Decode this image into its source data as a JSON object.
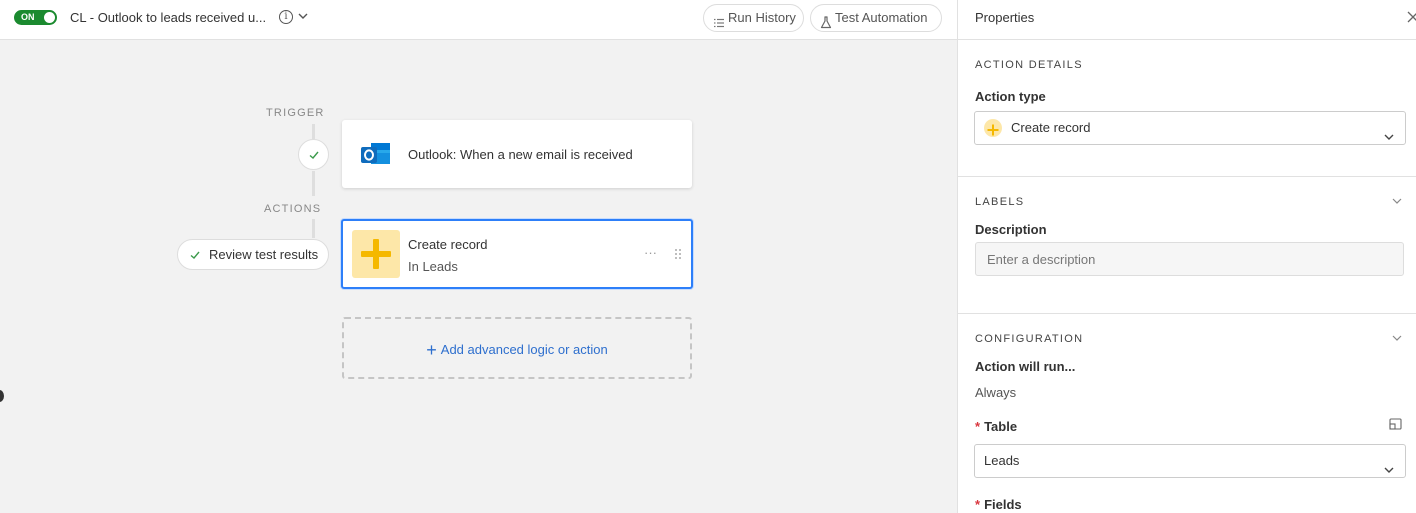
{
  "topbar": {
    "toggle_label": "ON",
    "automation_title": "CL - Outlook to leads received u...",
    "info_glyph": "i",
    "run_history_label": "Run History",
    "test_automation_label": "Test Automation"
  },
  "flow": {
    "trigger_label": "TRIGGER",
    "actions_label": "ACTIONS",
    "trigger_card_text": "Outlook: When a new email is received",
    "action_card_title": "Create record",
    "action_card_subtitle": "In Leads",
    "action_card_more": "···",
    "review_button_label": "Review test results",
    "add_action_label": "Add advanced logic or action",
    "add_action_plus": "+"
  },
  "panel": {
    "title": "Properties",
    "action_details": {
      "section_title": "ACTION DETAILS",
      "action_type_label": "Action type",
      "action_type_value": "Create record"
    },
    "labels": {
      "section_title": "LABELS",
      "description_label": "Description",
      "description_placeholder": "Enter a description",
      "description_value": ""
    },
    "configuration": {
      "section_title": "CONFIGURATION",
      "action_will_run_label": "Action will run...",
      "action_will_run_value": "Always",
      "table_label": "Table",
      "table_value": "Leads",
      "fields_label": "Fields",
      "required_marker": "*"
    }
  },
  "colors": {
    "toggle_on": "#1b8a2f",
    "selected_border": "#2d7ff9",
    "link_blue": "#2e6fce",
    "plus_tile_bg": "#fde7a8",
    "plus_color": "#f5b800",
    "outlook_blue": "#0f6cbd",
    "required_red": "#d9363e"
  },
  "icons": [
    "info-icon",
    "chevron-down-icon",
    "run-history-icon",
    "flask-icon",
    "check-icon",
    "outlook-icon",
    "plus-icon",
    "drag-handle-icon",
    "close-icon",
    "expand-icon"
  ]
}
